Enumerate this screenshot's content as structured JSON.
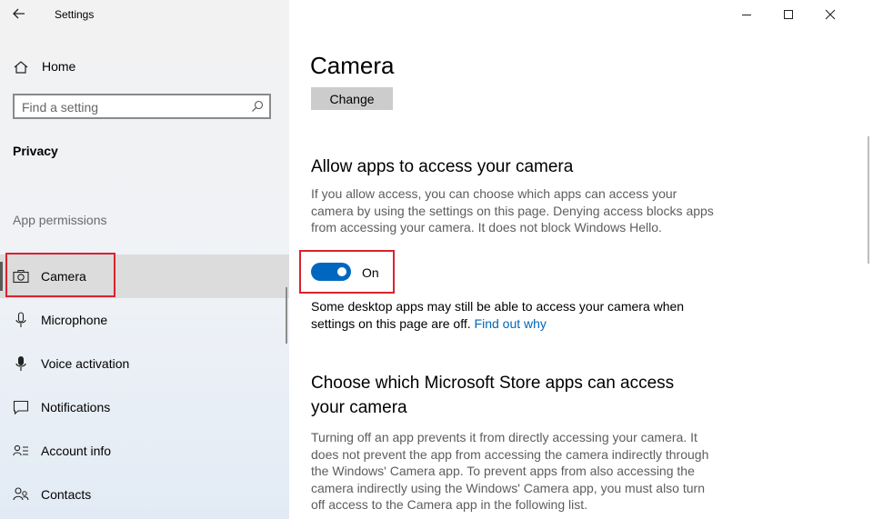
{
  "window": {
    "title": "Settings",
    "controls": [
      "minimize-icon",
      "maximize-icon",
      "close-icon"
    ]
  },
  "sidebar": {
    "home_label": "Home",
    "search_placeholder": "Find a setting",
    "section_title": "Privacy",
    "group_label": "App permissions",
    "items": [
      {
        "label": "Camera",
        "icon": "camera-icon",
        "selected": true
      },
      {
        "label": "Microphone",
        "icon": "microphone-icon",
        "selected": false
      },
      {
        "label": "Voice activation",
        "icon": "voice-activation-icon",
        "selected": false
      },
      {
        "label": "Notifications",
        "icon": "notifications-icon",
        "selected": false
      },
      {
        "label": "Account info",
        "icon": "account-info-icon",
        "selected": false
      },
      {
        "label": "Contacts",
        "icon": "contacts-icon",
        "selected": false
      }
    ]
  },
  "main": {
    "page_title": "Camera",
    "change_button": "Change",
    "allow_heading": "Allow apps to access your camera",
    "allow_description": "If you allow access, you can choose which apps can access your camera by using the settings on this page. Denying access blocks apps from accessing your camera. It does not block Windows Hello.",
    "toggle_state": "On",
    "desktop_note": "Some desktop apps may still be able to access your camera when settings on this page are off.",
    "find_out_link": "Find out why",
    "store_heading": "Choose which Microsoft Store apps can access your camera",
    "store_description": "Turning off an app prevents it from directly accessing your camera. It does not prevent the app from accessing the camera indirectly through the Windows' Camera app. To prevent apps from also accessing the camera indirectly using the Windows' Camera app, you must also turn off access to the Camera app in the following list."
  },
  "colors": {
    "accent": "#0067c0",
    "link": "#0067b8",
    "highlight_box": "#d9232e"
  }
}
